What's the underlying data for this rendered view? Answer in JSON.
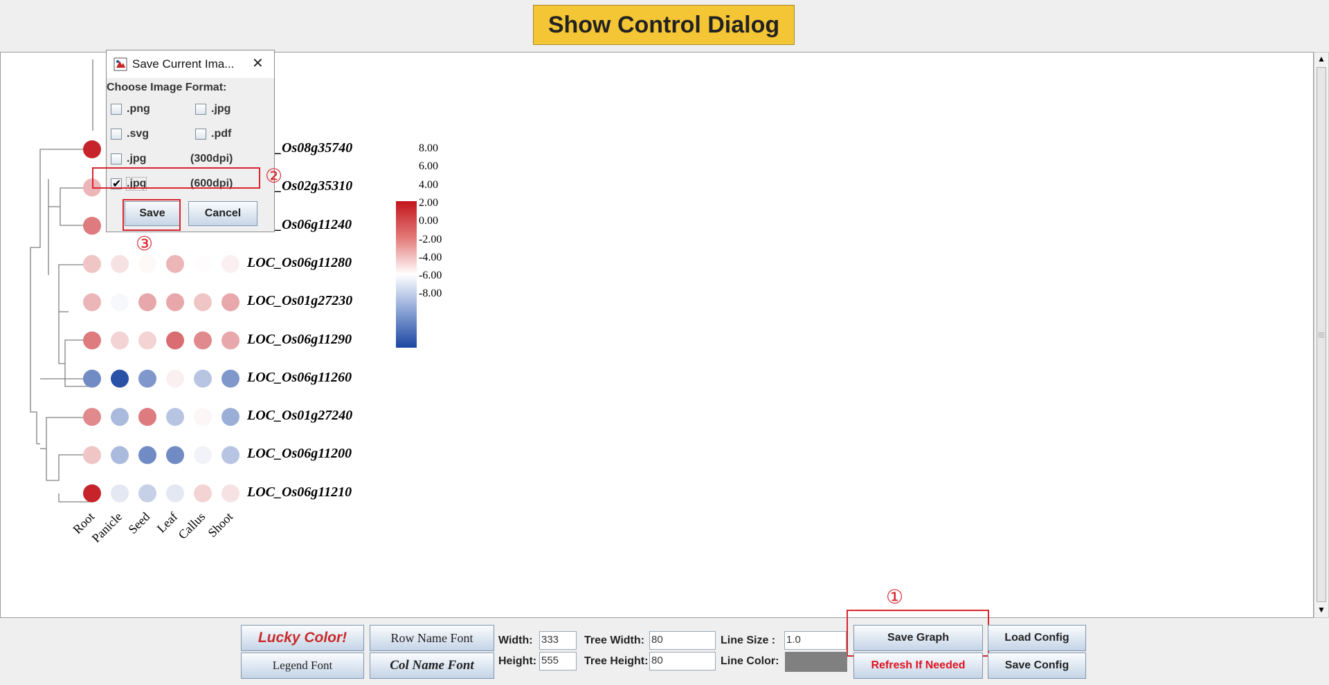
{
  "top_button": {
    "label": "Show Control Dialog"
  },
  "heatmap": {
    "genes": [
      "LOC_Os08g35740",
      "LOC_Os02g35310",
      "LOC_Os06g11240",
      "LOC_Os06g11280",
      "LOC_Os01g27230",
      "LOC_Os06g11290",
      "LOC_Os06g11260",
      "LOC_Os01g27240",
      "LOC_Os06g11200",
      "LOC_Os06g11210"
    ],
    "columns": [
      "Root",
      "Panicle",
      "Seed",
      "Leaf",
      "Callus",
      "Shoot"
    ],
    "legend_ticks": [
      "8.00",
      "6.00",
      "4.00",
      "2.00",
      "0.00",
      "-2.00",
      "-4.00",
      "-6.00",
      "-8.00"
    ],
    "legend_colors": {
      "high": "#c2151c",
      "mid": "#ffffff",
      "low": "#1b46a1"
    },
    "values": [
      [
        7.5,
        null,
        null,
        null,
        null,
        null
      ],
      [
        2.5,
        null,
        null,
        null,
        null,
        null
      ],
      [
        4.5,
        null,
        null,
        null,
        null,
        null
      ],
      [
        2.0,
        1.0,
        0.2,
        2.5,
        0.1,
        0.5
      ],
      [
        2.5,
        -0.3,
        3.0,
        3.0,
        2.0,
        3.0
      ],
      [
        4.5,
        1.5,
        1.5,
        5.0,
        4.0,
        3.0
      ],
      [
        -5.0,
        -7.5,
        -4.5,
        0.5,
        -2.5,
        -4.5
      ],
      [
        4.0,
        -3.0,
        4.5,
        -2.5,
        0.3,
        -3.5
      ],
      [
        2.0,
        -3.0,
        -5.0,
        -5.0,
        -0.5,
        -2.5
      ],
      [
        7.5,
        -1.0,
        -2.0,
        -1.0,
        1.5,
        1.0
      ]
    ]
  },
  "dialog": {
    "title": "Save Current Ima...",
    "prompt": "Choose Image Format:",
    "options": [
      {
        "label": ".png",
        "checked": false
      },
      {
        "label": ".jpg",
        "checked": false
      },
      {
        "label": ".svg",
        "checked": false
      },
      {
        "label": ".pdf",
        "checked": false
      },
      {
        "label": ".jpg",
        "checked": false,
        "dpi": "(300dpi)"
      },
      {
        "label": ".jpg",
        "checked": true,
        "dpi": "(600dpi)"
      }
    ],
    "save_label": "Save",
    "cancel_label": "Cancel"
  },
  "annotations": {
    "step1": "①",
    "step2": "②",
    "step3": "③"
  },
  "controls": {
    "lucky_color": "Lucky Color!",
    "legend_font": "Legend Font",
    "row_name_font": "Row Name Font",
    "col_name_font": "Col Name Font",
    "width_label": "Width:",
    "width_value": "333",
    "height_label": "Height:",
    "height_value": "555",
    "tree_width_label": "Tree Width:",
    "tree_width_value": "80",
    "tree_height_label": "Tree Height:",
    "tree_height_value": "80",
    "line_size_label": "Line Size :",
    "line_size_value": "1.0",
    "line_color_label": "Line Color:",
    "line_color": "#808080",
    "save_graph": "Save Graph",
    "refresh": "Refresh If Needed",
    "load_config": "Load Config",
    "save_config": "Save Config"
  }
}
